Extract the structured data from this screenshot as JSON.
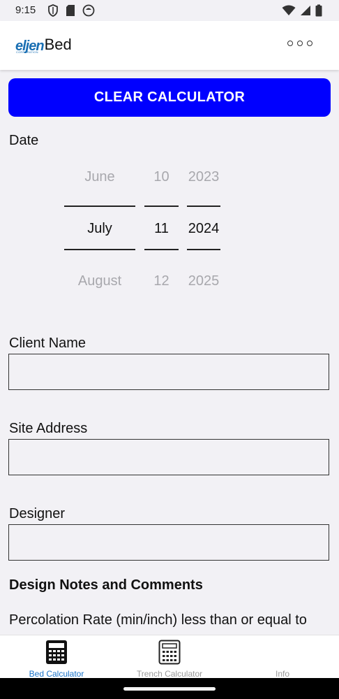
{
  "status_bar": {
    "time": "9:15",
    "left_icons": [
      "shield-icon",
      "sd-card-icon",
      "app-circle-icon"
    ],
    "right_icons": [
      "wifi-icon",
      "signal-icon",
      "battery-icon"
    ]
  },
  "app_bar": {
    "logo_text": "eljen",
    "logo_subtext": "CORPORATION",
    "title": "Bed",
    "menu_icon": "more-horizontal-icon"
  },
  "clear_button": {
    "label": "CLEAR CALCULATOR",
    "color": "#0000ff"
  },
  "date": {
    "label": "Date",
    "month": {
      "prev": "June",
      "selected": "July",
      "next": "August"
    },
    "day": {
      "prev": "10",
      "selected": "11",
      "next": "12"
    },
    "year": {
      "prev": "2023",
      "selected": "2024",
      "next": "2025"
    }
  },
  "fields": {
    "client_name": {
      "label": "Client Name",
      "value": ""
    },
    "site_address": {
      "label": "Site Address",
      "value": ""
    },
    "designer": {
      "label": "Designer",
      "value": ""
    }
  },
  "design_notes": {
    "title": "Design Notes and Comments",
    "percolation_text": "Percolation Rate (min/inch) less than or equal to"
  },
  "bottom_nav": {
    "active_color": "#1a73c8",
    "items": [
      {
        "label": "Bed Calculator",
        "icon": "calculator-icon",
        "active": true
      },
      {
        "label": "Trench Calculator",
        "icon": "calculator-outline-icon",
        "active": false
      },
      {
        "label": "Info",
        "icon": "",
        "active": false
      }
    ]
  }
}
